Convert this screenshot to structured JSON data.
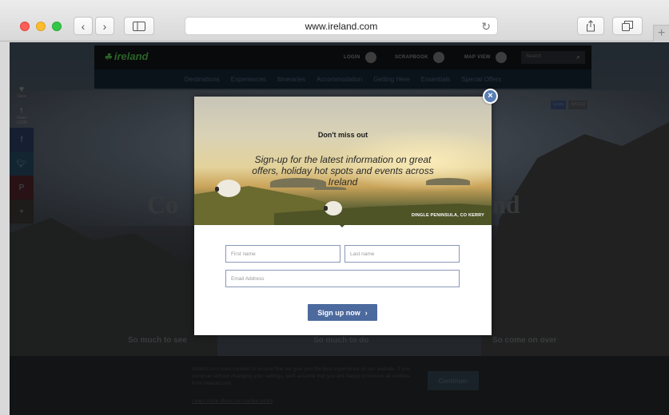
{
  "browser": {
    "url": "www.ireland.com",
    "back_icon": "chevron-left-icon",
    "forward_icon": "chevron-right-icon",
    "sidebar_icon": "sidebar-icon",
    "reload_icon": "reload-icon",
    "share_icon": "share-icon",
    "tabs_icon": "tabs-icon",
    "new_tab": "+"
  },
  "site": {
    "logo": "ireland",
    "nav": {
      "login": "LOGIN",
      "scrapbook": "SCRAPBOOK",
      "scrapbook_count": "0",
      "map_view": "MAP VIEW",
      "search_placeholder": "Search"
    },
    "menu": [
      "Destinations",
      "Experiences",
      "Itineraries",
      "Accommodation",
      "Getting Here",
      "Essentials",
      "Special Offers"
    ],
    "side_share": {
      "save_label": "Save",
      "share_label": "Share",
      "share_count": "11098"
    },
    "fb_badge": {
      "label": "Gosta",
      "count": "405.532"
    },
    "hero_left": "Co",
    "hero_right": "nd",
    "taglines": [
      "So much to see",
      "So much to do",
      "So come on over"
    ],
    "cookie": {
      "text": "Ireland.com uses cookies to ensure that we give you the best experience on our website. If you continue without changing your settings, we'll assume that you are happy to receive all cookies from Ireland.com.",
      "link": "Learn more about our cookie policy",
      "button": "Continue"
    }
  },
  "modal": {
    "headline": "Don't miss out",
    "subhead": "Sign-up for the latest information on great offers, holiday hot spots and events across Ireland",
    "caption": "DINGLE PENINSULA, CO KERRY",
    "close": "×",
    "first_name_placeholder": "First name",
    "last_name_placeholder": "Last name",
    "email_placeholder": "Email Address",
    "submit": "Sign up now",
    "submit_arrow": "›"
  },
  "colors": {
    "accent": "#4c6a9e",
    "close_button": "#5a7fb5",
    "field_border": "#8a97b8",
    "logo_green": "#3a8a3a"
  }
}
